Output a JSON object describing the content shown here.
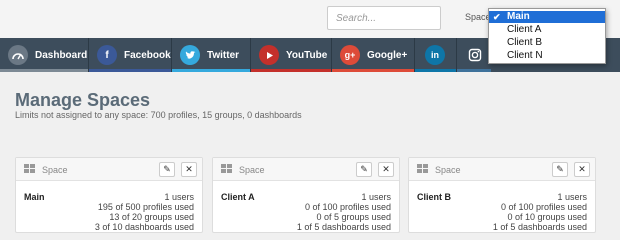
{
  "header": {
    "search_placeholder": "Search...",
    "space_label": "Space:"
  },
  "space_select": {
    "options": [
      "Main",
      "Client A",
      "Client B",
      "Client N"
    ],
    "selected": "Main"
  },
  "nav": {
    "items": [
      {
        "label": "Dashboard",
        "icon": "dashboard-gauge-icon",
        "color": "#7d8a95"
      },
      {
        "label": "Facebook",
        "icon": "facebook-icon",
        "color": "#3b5998"
      },
      {
        "label": "Twitter",
        "icon": "twitter-icon",
        "color": "#35a9dd"
      },
      {
        "label": "YouTube",
        "icon": "youtube-icon",
        "color": "#c4302b"
      },
      {
        "label": "Google+",
        "icon": "google-plus-icon",
        "color": "#dd4b39"
      },
      {
        "label": "",
        "icon": "linkedin-icon",
        "color": "#0e76a8"
      },
      {
        "label": "",
        "icon": "instagram-icon",
        "color": "#3f729b"
      }
    ]
  },
  "page": {
    "title": "Manage Spaces",
    "subtitle": "Limits not assigned to any space: 700 profiles, 15 groups, 0 dashboards"
  },
  "cards": [
    {
      "header": "Space",
      "name": "Main",
      "users": "1 users",
      "profiles": "195 of 500 profiles used",
      "groups": "13 of 20 groups used",
      "dashboards": "3 of 10 dashboards used"
    },
    {
      "header": "Space",
      "name": "Client A",
      "users": "1 users",
      "profiles": "0 of 100 profiles used",
      "groups": "0 of 5 groups used",
      "dashboards": "1 of 5 dashboards used"
    },
    {
      "header": "Space",
      "name": "Client B",
      "users": "1 users",
      "profiles": "0 of 100 profiles used",
      "groups": "0 of 10 groups used",
      "dashboards": "1 of 5 dashboards used"
    }
  ],
  "icons": {
    "edit": "pencil-icon",
    "delete": "close-icon",
    "space": "grid-icon",
    "selected": "checkmark-icon"
  },
  "colors": {
    "nav_bg": "#3d4d5c",
    "select_highlight": "#1f6ed6",
    "title": "#5b6b78"
  }
}
